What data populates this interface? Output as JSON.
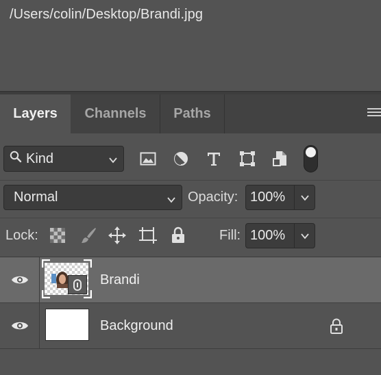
{
  "info": {
    "file_path": "/Users/colin/Desktop/Brandi.jpg"
  },
  "tabs": [
    {
      "label": "Layers",
      "active": true
    },
    {
      "label": "Channels",
      "active": false
    },
    {
      "label": "Paths",
      "active": false
    }
  ],
  "filter": {
    "kind_label": "Kind",
    "icons": [
      "image-filter-icon",
      "adjustment-filter-icon",
      "type-filter-icon",
      "shape-filter-icon",
      "smart-object-filter-icon"
    ],
    "filter_toggle_on": true
  },
  "blend": {
    "mode": "Normal",
    "opacity_label": "Opacity:",
    "opacity_value": "100%"
  },
  "lock": {
    "label": "Lock:",
    "icons": [
      "lock-transparent-pixels-icon",
      "lock-image-pixels-icon",
      "lock-position-icon",
      "lock-artboard-icon",
      "lock-all-icon"
    ],
    "fill_label": "Fill:",
    "fill_value": "100%"
  },
  "layers": [
    {
      "name": "Brandi",
      "visible": true,
      "selected": true,
      "smart_object": true,
      "locked": false
    },
    {
      "name": "Background",
      "visible": true,
      "selected": false,
      "smart_object": false,
      "locked": true
    }
  ],
  "colors": {
    "panel_bg": "#535353",
    "tab_bar_bg": "#424242",
    "selected_row": "#6a6a6a",
    "field_bg": "#3c3c3c"
  }
}
